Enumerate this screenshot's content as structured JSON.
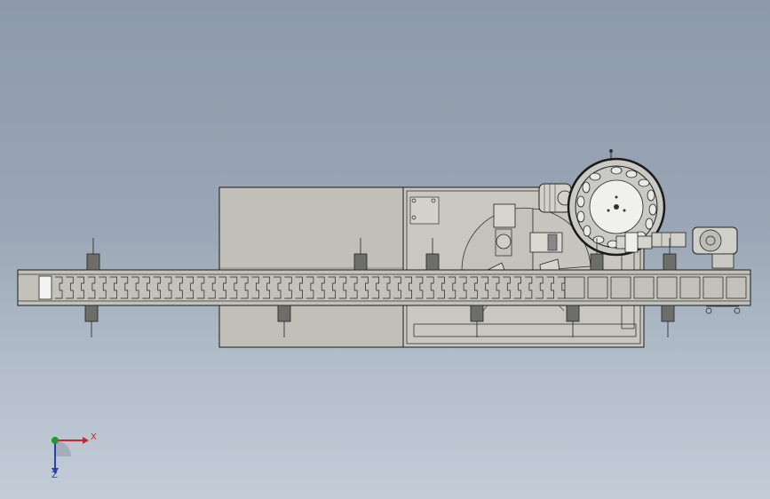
{
  "window": {
    "title": ""
  },
  "viewport": {
    "background_top": "#8d9aa9",
    "background_bottom": "#c3ccd7"
  },
  "model": {
    "type": "conveyor-assembly-top-view",
    "line_color": "#1a1a1a",
    "frame_fill": "#c9c8c0",
    "conveyor_fill": "#c3c2ba",
    "cabinet_fill": "#bfbeb6",
    "disc_fill": "#e8e8e4"
  },
  "triad": {
    "x_label": "X",
    "z_label": "Z",
    "x_color": "#d0242b",
    "y_color": "#1e9a2e",
    "z_color": "#2b3fb8"
  }
}
